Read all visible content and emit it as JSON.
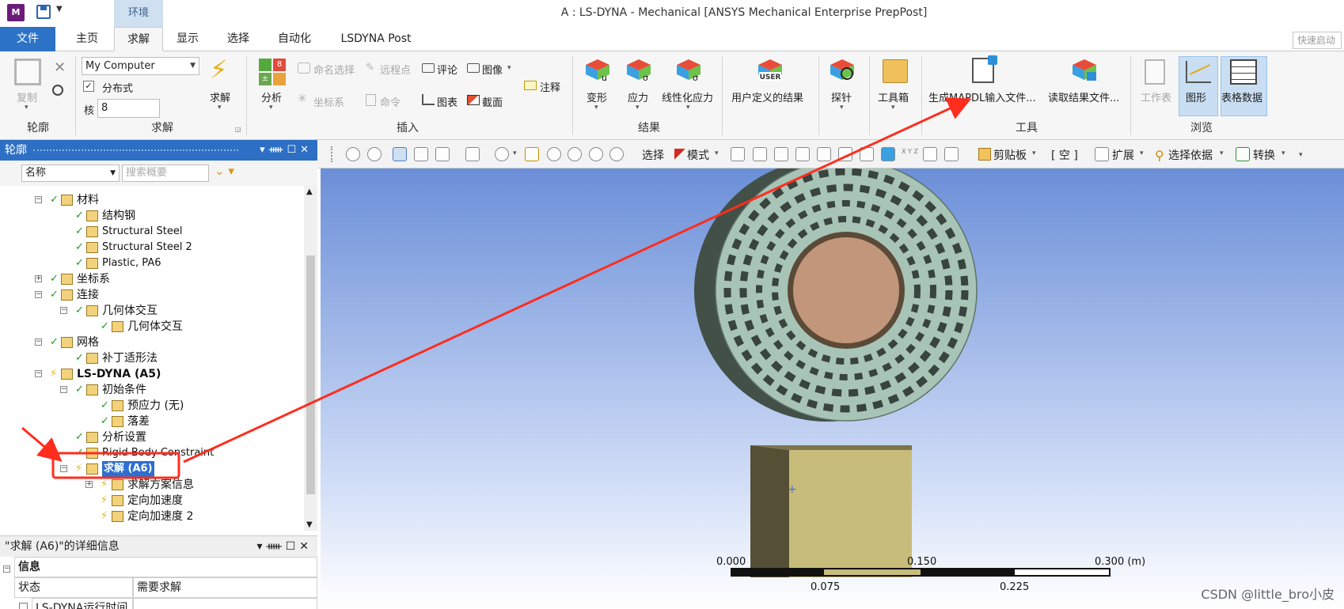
{
  "titlebar": {
    "app_icon": "M",
    "context_tab": "环境",
    "title": "A : LS-DYNA - Mechanical [ANSYS Mechanical Enterprise PrepPost]"
  },
  "tabs": {
    "file": "文件",
    "items": [
      "主页",
      "求解",
      "显示",
      "选择",
      "自动化",
      "LSDYNA Post"
    ],
    "active": "求解",
    "quick_launch": "快速启动"
  },
  "ribbon": {
    "outline_group": {
      "label": "轮廓",
      "copy": "复制"
    },
    "solve_group": {
      "label": "求解",
      "environment": "My Computer",
      "distributed": "分布式",
      "cores_label": "核",
      "cores_value": "8",
      "solve_button": "求解"
    },
    "insert_group": {
      "label": "插入",
      "analysis": "分析",
      "named_selection": "命名选择",
      "remote_point": "远程点",
      "comment": "评论",
      "image": "图像",
      "annotation": "注释",
      "coordinate_system": "坐标系",
      "command": "命令",
      "chart": "图表",
      "section": "截面"
    },
    "results_group": {
      "label": "结果",
      "deformation": "变形",
      "stress": "应力",
      "linearized_stress": "线性化应力",
      "user_defined": "用户定义的结果"
    },
    "probe": "探针",
    "toolbox": "工具箱",
    "tools_group": {
      "label": "工具",
      "write_mapdl": "生成MAPDL输入文件...",
      "read_results": "读取结果文件..."
    },
    "browse_group": {
      "label": "浏览",
      "worksheet": "工作表",
      "graph": "图形",
      "tabular": "表格数据"
    },
    "icons": {
      "user_badge": "USER",
      "result_letter_u": "u",
      "result_letter_sigma": "σ",
      "solve_num_a": "8",
      "solve_num_b": "±"
    }
  },
  "outline": {
    "title": "轮廓",
    "name_filter": "名称",
    "search_placeholder": "搜索概要",
    "tree": [
      {
        "label": "材料",
        "depth": 1,
        "state": "check",
        "expander": "minus"
      },
      {
        "label": "结构钢",
        "depth": 2,
        "state": "check"
      },
      {
        "label": "Structural Steel",
        "depth": 2,
        "state": "check"
      },
      {
        "label": "Structural Steel 2",
        "depth": 2,
        "state": "check"
      },
      {
        "label": "Plastic, PA6",
        "depth": 2,
        "state": "check"
      },
      {
        "label": "坐标系",
        "depth": 1,
        "state": "check",
        "expander": "plus"
      },
      {
        "label": "连接",
        "depth": 1,
        "state": "check",
        "expander": "minus"
      },
      {
        "label": "几何体交互",
        "depth": 2,
        "state": "check",
        "expander": "minus"
      },
      {
        "label": "几何体交互",
        "depth": 3,
        "state": "check"
      },
      {
        "label": "网格",
        "depth": 1,
        "state": "check",
        "expander": "minus"
      },
      {
        "label": "补丁适形法",
        "depth": 2,
        "state": "check"
      },
      {
        "label": "LS-DYNA (A5)",
        "depth": 1,
        "state": "bolt",
        "expander": "minus",
        "bold": true
      },
      {
        "label": "初始条件",
        "depth": 2,
        "state": "check",
        "expander": "minus"
      },
      {
        "label": "预应力 (无)",
        "depth": 3,
        "state": "check"
      },
      {
        "label": "落差",
        "depth": 3,
        "state": "check"
      },
      {
        "label": "分析设置",
        "depth": 2,
        "state": "check"
      },
      {
        "label": "Rigid Body Constraint",
        "depth": 2,
        "state": "check"
      },
      {
        "label": "求解 (A6)",
        "depth": 2,
        "state": "bolt",
        "expander": "minus",
        "selected": true
      },
      {
        "label": "求解方案信息",
        "depth": 3,
        "state": "bolt",
        "expander": "plus"
      },
      {
        "label": "定向加速度",
        "depth": 3,
        "state": "bolt"
      },
      {
        "label": "定向加速度 2",
        "depth": 3,
        "state": "bolt"
      }
    ]
  },
  "details": {
    "title": "\"求解 (A6)\"的详细信息",
    "section": "信息",
    "rows": [
      {
        "key": "状态",
        "value": "需要求解"
      },
      {
        "key": "LS-DYNA运行时间",
        "value": ""
      }
    ]
  },
  "graphics_toolbar": {
    "select": "选择",
    "mode": "模式",
    "clipboard": "剪贴板",
    "empty": "[ 空 ]",
    "extend": "扩展",
    "select_by": "选择依据",
    "convert": "转换",
    "xyz_label": "X Y Z"
  },
  "viewport": {
    "scale_labels_top": [
      "0.000",
      "0.150",
      "0.300 (m)"
    ],
    "scale_labels_bottom": [
      "0.075",
      "0.225"
    ],
    "watermark": "CSDN @little_bro小皮"
  },
  "colors": {
    "accent": "#2c73c7",
    "selection": "#2e6fd0",
    "annotation_red": "#ff2d1e",
    "wheel": "#a7c4b7",
    "hub": "#c2967a",
    "block": "#c8bc7a"
  }
}
